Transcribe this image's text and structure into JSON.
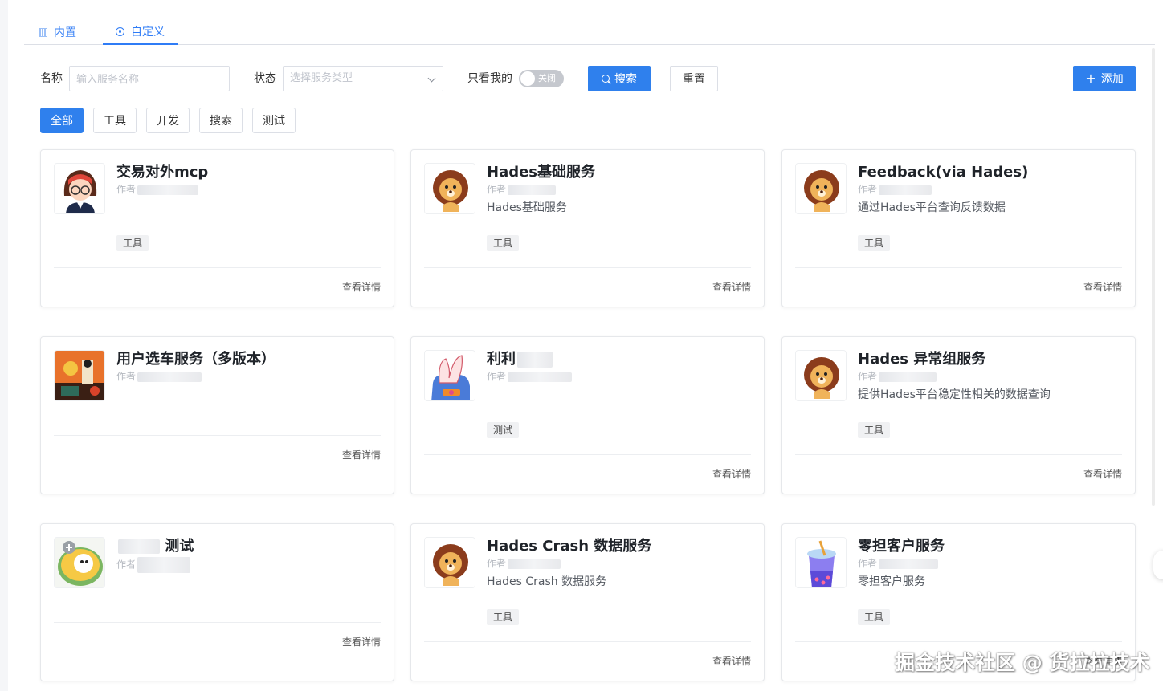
{
  "tabs": [
    {
      "label": "内置",
      "icon": "grid-icon"
    },
    {
      "label": "自定义",
      "icon": "target-icon",
      "active": true
    }
  ],
  "filters": {
    "name_label": "名称",
    "name_placeholder": "输入服务名称",
    "status_label": "状态",
    "status_placeholder": "选择服务类型",
    "mine_label": "只看我的",
    "mine_switch_text": "关闭",
    "search_label": "搜索",
    "reset_label": "重置",
    "add_label": "添加"
  },
  "categories": [
    {
      "label": "全部",
      "active": true
    },
    {
      "label": "工具"
    },
    {
      "label": "开发"
    },
    {
      "label": "搜索"
    },
    {
      "label": "测试"
    }
  ],
  "cards": [
    {
      "title": "交易对外mcp",
      "author": "作者",
      "description": "",
      "tag": "工具",
      "detail": "查看详情",
      "avatar": "girl-avatar"
    },
    {
      "title": "Hades基础服务",
      "author": "作者",
      "description": "Hades基础服务",
      "tag": "工具",
      "detail": "查看详情",
      "avatar": "lion-avatar"
    },
    {
      "title": "Feedback(via Hades)",
      "author": "作者",
      "description": "通过Hades平台查询反馈数据",
      "tag": "工具",
      "detail": "查看详情",
      "avatar": "lion-avatar"
    },
    {
      "title": "用户选车服务（多版本）",
      "author": "作者",
      "description": "",
      "tag": "",
      "detail": "查看详情",
      "avatar": "painting-avatar"
    },
    {
      "title": "利利",
      "author": "作者",
      "description": "",
      "tag": "测试",
      "detail": "查看详情",
      "avatar": "hand-avatar"
    },
    {
      "title": "Hades 异常组服务",
      "author": "作者",
      "description": "提供Hades平台稳定性相关的数据查询",
      "tag": "工具",
      "detail": "查看详情",
      "avatar": "lion-avatar"
    },
    {
      "title": "测试",
      "author": "作者",
      "description": "",
      "tag": "",
      "detail": "查看详情",
      "avatar": "bowl-avatar"
    },
    {
      "title": "Hades Crash 数据服务",
      "author": "作者",
      "description": "Hades Crash 数据服务",
      "tag": "工具",
      "detail": "查看详情",
      "avatar": "lion-avatar"
    },
    {
      "title": "零担客户服务",
      "author": "作者",
      "description": "零担客户服务",
      "tag": "工具",
      "detail": "查看详情",
      "avatar": "bubble-tea-avatar"
    }
  ],
  "watermark": "掘金技术社区 @ 货拉拉技术",
  "colors": {
    "primary": "#2f80ed",
    "tag_bg": "#f0f1f3",
    "border": "#dcdfe6"
  }
}
